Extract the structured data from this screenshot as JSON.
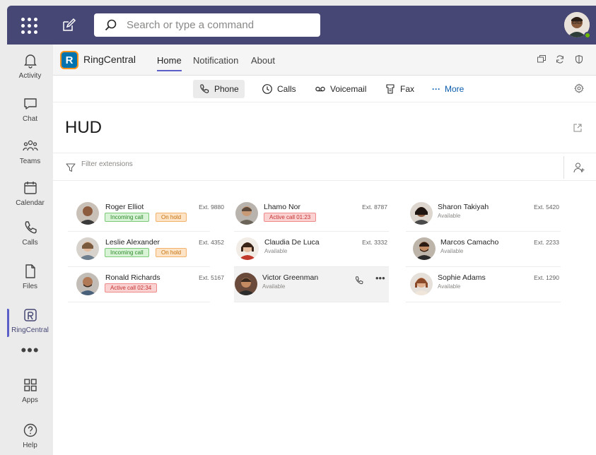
{
  "topbar": {
    "search_placeholder": "Search or type a command"
  },
  "rail": {
    "items": [
      {
        "label": "Activity",
        "icon": "bell-icon"
      },
      {
        "label": "Chat",
        "icon": "chat-icon"
      },
      {
        "label": "Teams",
        "icon": "teams-icon"
      },
      {
        "label": "Calendar",
        "icon": "calendar-icon"
      },
      {
        "label": "Calls",
        "icon": "phone-icon"
      },
      {
        "label": "Files",
        "icon": "file-icon"
      },
      {
        "label": "RingCentral",
        "icon": "ringcentral-icon"
      },
      {
        "label": "Apps",
        "icon": "apps-icon"
      },
      {
        "label": "Help",
        "icon": "help-icon"
      }
    ],
    "more_label": "•••"
  },
  "app": {
    "name": "RingCentral",
    "logo_letter": "R",
    "tabs": [
      "Home",
      "Notification",
      "About"
    ],
    "active_tab": "Home"
  },
  "subnav": {
    "items": [
      {
        "label": "Phone",
        "icon": "phone-icon"
      },
      {
        "label": "Calls",
        "icon": "clock-icon"
      },
      {
        "label": "Voicemail",
        "icon": "voicemail-icon"
      },
      {
        "label": "Fax",
        "icon": "fax-icon"
      },
      {
        "label": "More",
        "icon": "ellipsis-icon"
      }
    ],
    "more_prefix": "···"
  },
  "hud": {
    "title": "HUD",
    "filter_placeholder": "Filter extensions"
  },
  "columns": [
    [
      {
        "name": "Roger Elliot",
        "ext": "Ext. 9880",
        "badges": [
          {
            "text": "Incoming call",
            "kind": "incoming"
          },
          {
            "text": "On hold",
            "kind": "hold"
          }
        ]
      },
      {
        "name": "Leslie Alexander",
        "ext": "Ext. 4352",
        "badges": [
          {
            "text": "Incoming call",
            "kind": "incoming"
          },
          {
            "text": "On hold",
            "kind": "hold"
          }
        ]
      },
      {
        "name": "Ronald Richards",
        "ext": "Ext. 5167",
        "badges": [
          {
            "text": "Active call 02:34",
            "kind": "active"
          }
        ]
      }
    ],
    [
      {
        "name": "Lhamo Nor",
        "ext": "Ext. 8787",
        "badges": [
          {
            "text": "Active call 01:23",
            "kind": "active"
          }
        ]
      },
      {
        "name": "Claudia De Luca",
        "ext": "Ext. 3332",
        "status": "Available"
      },
      {
        "name": "Victor Greenman",
        "status": "Available",
        "hover": true
      }
    ],
    [
      {
        "name": "Sharon Takiyah",
        "ext": "Ext. 5420",
        "status": "Available"
      },
      {
        "name": "Marcos Camacho",
        "ext": "Ext. 2233",
        "status": "Available"
      },
      {
        "name": "Sophie Adams",
        "ext": "Ext. 1290",
        "status": "Available"
      }
    ]
  ]
}
